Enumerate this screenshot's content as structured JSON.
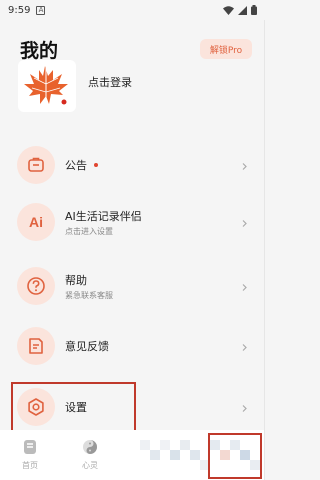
{
  "status_bar": {
    "time": "9:59",
    "notification_glyph": "A"
  },
  "header": {
    "title": "我的",
    "pro_button": "解锁Pro",
    "login_text": "点击登录"
  },
  "menu": [
    {
      "id": "announcement",
      "label": "公告",
      "subtitle": "",
      "icon": "briefcase-icon",
      "has_dot": true
    },
    {
      "id": "ai-companion",
      "label": "AI生活记录伴侣",
      "subtitle": "点击进入设置",
      "icon": "ai-icon",
      "has_dot": false
    },
    {
      "id": "help",
      "label": "帮助",
      "subtitle": "紧急联系客服",
      "icon": "question-icon",
      "has_dot": false
    },
    {
      "id": "feedback",
      "label": "意见反馈",
      "subtitle": "",
      "icon": "document-icon",
      "has_dot": false
    },
    {
      "id": "settings",
      "label": "设置",
      "subtitle": "",
      "icon": "gear-icon",
      "has_dot": false
    }
  ],
  "bottom_nav": [
    {
      "label": "首页",
      "icon": "home-icon"
    },
    {
      "label": "心灵",
      "icon": "yin-yang-icon"
    }
  ],
  "colors": {
    "accent": "#e0623f",
    "icon_bg": "#fbe4dc",
    "highlight": "#c0392b"
  }
}
